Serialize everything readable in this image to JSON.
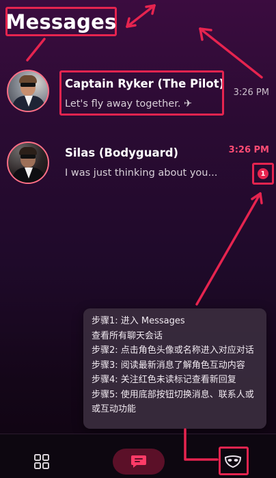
{
  "header": {
    "title": "Messages"
  },
  "chats": [
    {
      "name": "Captain Ryker (The Pilot)",
      "preview": "Let's fly away together. ✈",
      "time": "3:26 PM",
      "unread": false,
      "avatar_icon": "pilot-avatar"
    },
    {
      "name": "Silas (Bodyguard)",
      "preview": "I was just thinking about you...",
      "time": "3:26 PM",
      "unread": true,
      "unread_count": "1",
      "avatar_icon": "bodyguard-avatar"
    }
  ],
  "tip": {
    "lines": [
      "步骤1: 进入 Messages",
      "查看所有聊天会话",
      "步骤2: 点击角色头像或名称进入对应对话",
      "步骤3: 阅读最新消息了解角色互动内容",
      "步骤4: 关注红色未读标记查看新回复",
      "步骤5: 使用底部按钮切换消息、联系人或",
      "或互动功能"
    ]
  },
  "bottom_nav": {
    "items": [
      {
        "icon": "grid-icon"
      },
      {
        "icon": "chat-icon",
        "active": true
      },
      {
        "icon": "mask-icon"
      }
    ]
  },
  "colors": {
    "accent": "#e6244f",
    "unread_time": "#ff4c74",
    "active_tab_bg": "#5b1028"
  }
}
